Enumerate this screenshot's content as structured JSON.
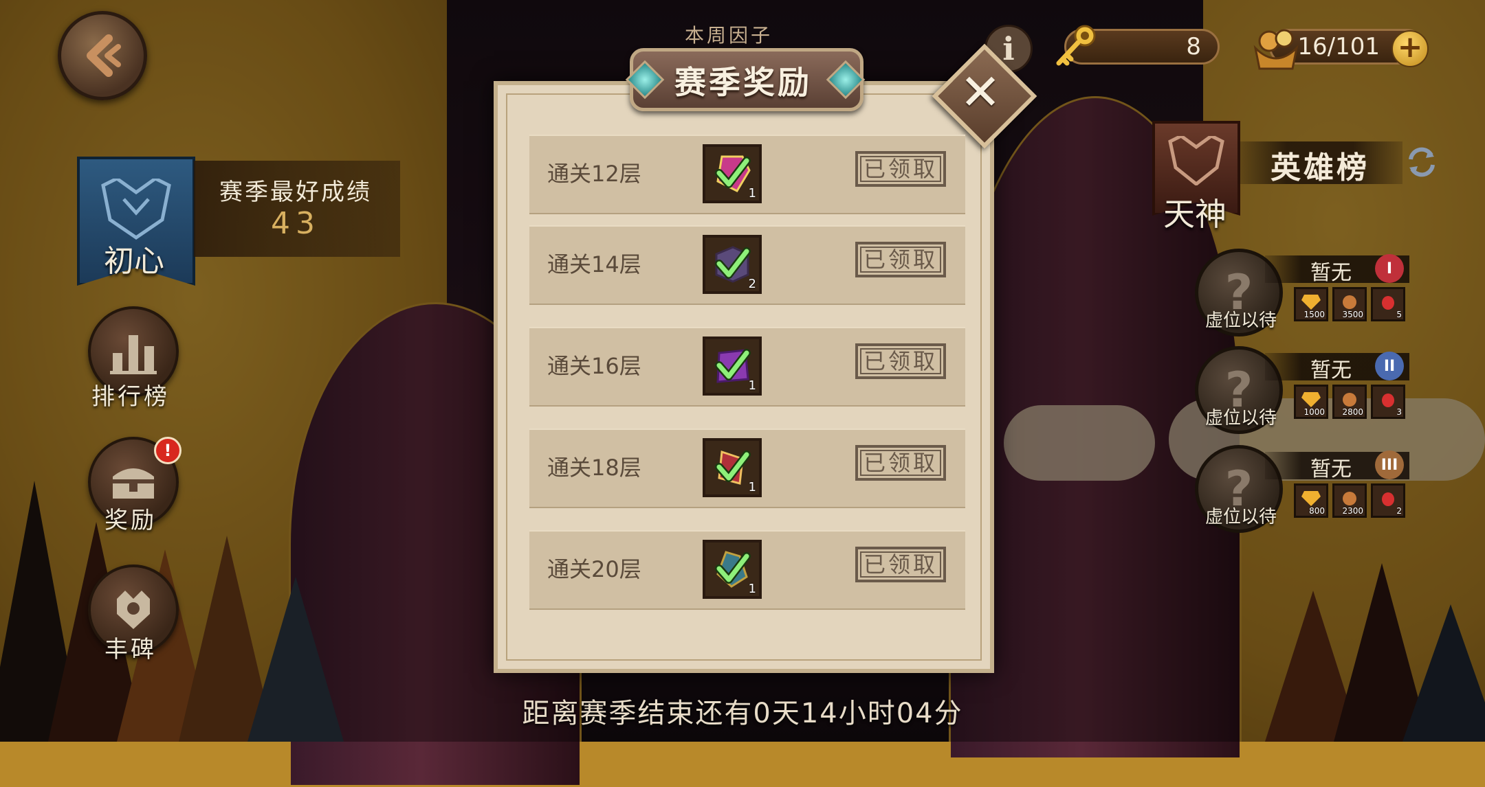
{
  "top": {
    "weekly_factor": "本周因子",
    "keys": "8",
    "stamina": "16/101",
    "plus": "+",
    "info": "i"
  },
  "left": {
    "season_rank": "初心",
    "best_label": "赛季最好成绩",
    "best_value": "43",
    "buttons": [
      {
        "label": "排行榜",
        "icon": "leaderboard-icon"
      },
      {
        "label": "奖励",
        "icon": "chest-icon",
        "badge": "!"
      },
      {
        "label": "丰碑",
        "icon": "monument-icon"
      }
    ]
  },
  "right": {
    "tier": "天神",
    "title": "英雄榜",
    "slots": [
      {
        "name": "暂无",
        "vacant": "虚位以待",
        "medal": "I",
        "medal_color": "#c0303a",
        "rewards": [
          "1500",
          "3500",
          "5"
        ]
      },
      {
        "name": "暂无",
        "vacant": "虚位以待",
        "medal": "II",
        "medal_color": "#4a6ab0",
        "rewards": [
          "1000",
          "2800",
          "3"
        ]
      },
      {
        "name": "暂无",
        "vacant": "虚位以待",
        "medal": "III",
        "medal_color": "#a06a3a",
        "rewards": [
          "800",
          "2300",
          "2"
        ]
      }
    ]
  },
  "modal": {
    "title": "赛季奖励",
    "close": "✕",
    "rows": [
      {
        "label": "通关12层",
        "qty": "1",
        "status": "已领取",
        "color": "#c83a8a"
      },
      {
        "label": "通关14层",
        "qty": "2",
        "status": "已领取",
        "color": "#5a4a7a"
      },
      {
        "label": "通关16层",
        "qty": "1",
        "status": "已领取",
        "color": "#8a3ab0"
      },
      {
        "label": "通关18层",
        "qty": "1",
        "status": "已领取",
        "color": "#b0303a"
      },
      {
        "label": "通关20层",
        "qty": "1",
        "status": "已领取",
        "color": "#3a7a8a"
      }
    ]
  },
  "countdown": "距离赛季结束还有0天14小时04分",
  "colors": {
    "accent": "#b8892a",
    "parchment": "#e3d5bd",
    "row": "#d0bfa3",
    "check": "#8ef07a"
  }
}
